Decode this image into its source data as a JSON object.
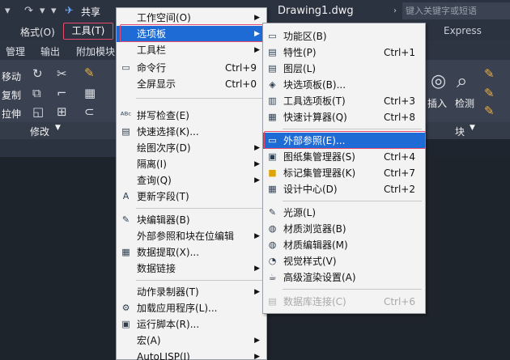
{
  "titlebar": {
    "share": "共享",
    "document": "Drawing1.dwg",
    "search_placeholder": "键入关键字或短语"
  },
  "menubar": {
    "format": "格式(O)",
    "tools": "工具(T)",
    "right_item": "Express"
  },
  "ribbon_tabs": {
    "manage": "管理",
    "output": "输出",
    "addons": "附加模块"
  },
  "ribbon": {
    "move": "移动",
    "copy": "复制",
    "stretch": "拉伸",
    "modify": "修改",
    "insert": "插入",
    "detect": "检测",
    "block": "块"
  },
  "menu1": {
    "items": [
      {
        "label": "工作空间(O)"
      },
      {
        "label": "选项板"
      },
      {
        "label": "工具栏"
      },
      {
        "label": "命令行",
        "shortcut": "Ctrl+9"
      },
      {
        "label": "全屏显示",
        "shortcut": "Ctrl+0"
      },
      {
        "label": "拼写检查(E)"
      },
      {
        "label": "快速选择(K)..."
      },
      {
        "label": "绘图次序(D)"
      },
      {
        "label": "隔离(I)"
      },
      {
        "label": "查询(Q)"
      },
      {
        "label": "更新字段(T)"
      },
      {
        "label": "块编辑器(B)"
      },
      {
        "label": "外部参照和块在位编辑"
      },
      {
        "label": "数据提取(X)..."
      },
      {
        "label": "数据链接"
      },
      {
        "label": "动作录制器(T)"
      },
      {
        "label": "加载应用程序(L)..."
      },
      {
        "label": "运行脚本(R)..."
      },
      {
        "label": "宏(A)"
      },
      {
        "label": "AutoLISP(I)"
      }
    ]
  },
  "menu2": {
    "items": [
      {
        "label": "功能区(B)"
      },
      {
        "label": "特性(P)",
        "shortcut": "Ctrl+1"
      },
      {
        "label": "图层(L)"
      },
      {
        "label": "块选项板(B)..."
      },
      {
        "label": "工具选项板(T)",
        "shortcut": "Ctrl+3"
      },
      {
        "label": "快速计算器(Q)",
        "shortcut": "Ctrl+8"
      },
      {
        "label": "外部参照(E)..."
      },
      {
        "label": "图纸集管理器(S)",
        "shortcut": "Ctrl+4"
      },
      {
        "label": "标记集管理器(K)",
        "shortcut": "Ctrl+7"
      },
      {
        "label": "设计中心(D)",
        "shortcut": "Ctrl+2"
      },
      {
        "label": "光源(L)"
      },
      {
        "label": "材质浏览器(B)"
      },
      {
        "label": "材质编辑器(M)"
      },
      {
        "label": "视觉样式(V)"
      },
      {
        "label": "高级渲染设置(A)"
      },
      {
        "label": "数据库连接(C)",
        "shortcut": "Ctrl+6"
      }
    ]
  },
  "colors": {
    "highlight": "#1e6bd6",
    "outline": "#e74a6a"
  }
}
